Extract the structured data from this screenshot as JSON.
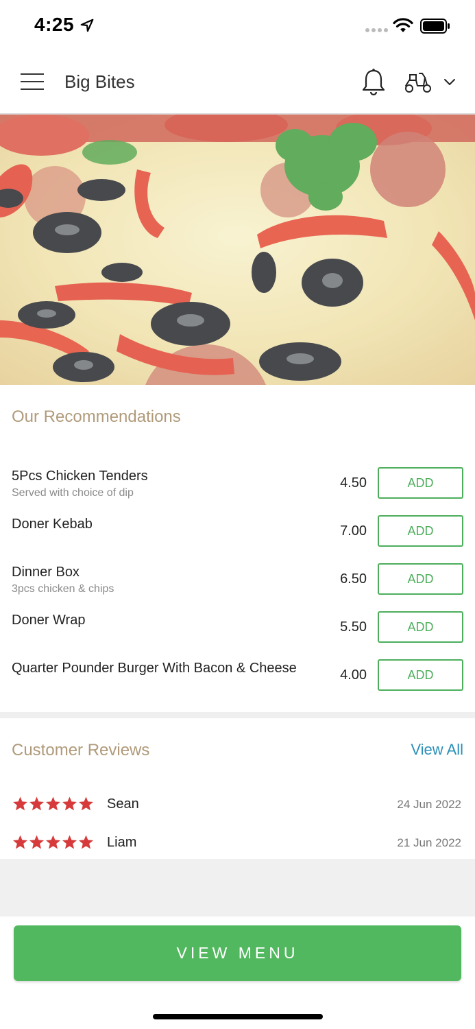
{
  "status_bar": {
    "time": "4:25",
    "icons": [
      "location-arrow-icon",
      "signal-icon",
      "wifi-icon",
      "battery-icon"
    ]
  },
  "header": {
    "brand": "Big Bites",
    "icons": [
      "hamburger-menu-icon",
      "bell-icon",
      "scooter-icon",
      "chevron-down-icon"
    ]
  },
  "hero": {
    "image": "pizza-photo"
  },
  "recommendations": {
    "title": "Our Recommendations",
    "add_label": "ADD",
    "items": [
      {
        "name": "5Pcs Chicken Tenders",
        "desc": "Served with choice of dip",
        "price": "4.50"
      },
      {
        "name": "Doner Kebab",
        "desc": "",
        "price": "7.00"
      },
      {
        "name": "Dinner Box",
        "desc": "3pcs chicken & chips",
        "price": "6.50"
      },
      {
        "name": "Doner Wrap",
        "desc": "",
        "price": "5.50"
      },
      {
        "name": "Quarter Pounder Burger With Bacon & Cheese",
        "desc": "",
        "price": "4.00"
      }
    ]
  },
  "reviews": {
    "title": "Customer Reviews",
    "view_all": "View All",
    "items": [
      {
        "name": "Sean",
        "rating": 5,
        "date": "24 Jun 2022"
      },
      {
        "name": "Liam",
        "rating": 5,
        "date": "21 Jun 2022"
      }
    ]
  },
  "cta": {
    "label": "VIEW MENU"
  },
  "colors": {
    "accent_green": "#52b85f",
    "section_title": "#b09a7a",
    "link_blue": "#2a8fb8",
    "star_red": "#d63a3a"
  }
}
